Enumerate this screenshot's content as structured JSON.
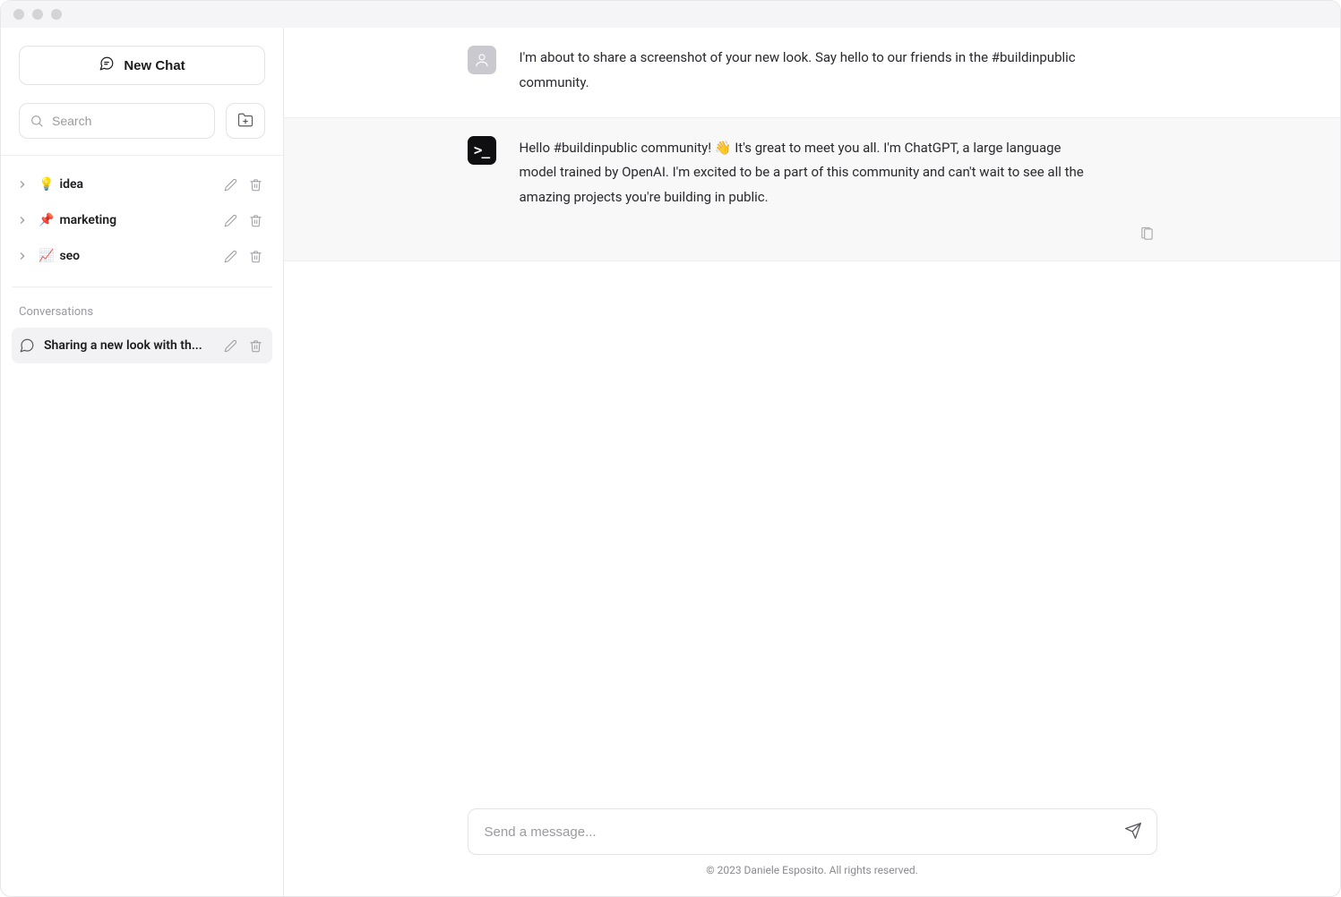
{
  "sidebar": {
    "newChatLabel": "New Chat",
    "searchPlaceholder": "Search",
    "folders": [
      {
        "emoji": "💡",
        "label": "idea"
      },
      {
        "emoji": "📌",
        "label": "marketing"
      },
      {
        "emoji": "📈",
        "label": "seo"
      }
    ],
    "conversationsLabel": "Conversations",
    "conversations": [
      {
        "title": "Sharing a new look with th..."
      }
    ]
  },
  "messages": [
    {
      "role": "user",
      "text": "I'm about to share a screenshot of your new look. Say hello to our friends in the #buildinpublic community."
    },
    {
      "role": "assistant",
      "text": "Hello #buildinpublic community! 👋 It's great to meet you all. I'm ChatGPT, a large language model trained by OpenAI. I'm excited to be a part of this community and can't wait to see all the amazing projects you're building in public."
    }
  ],
  "composer": {
    "placeholder": "Send a message..."
  },
  "footer": "© 2023 Daniele Esposito. All rights reserved."
}
